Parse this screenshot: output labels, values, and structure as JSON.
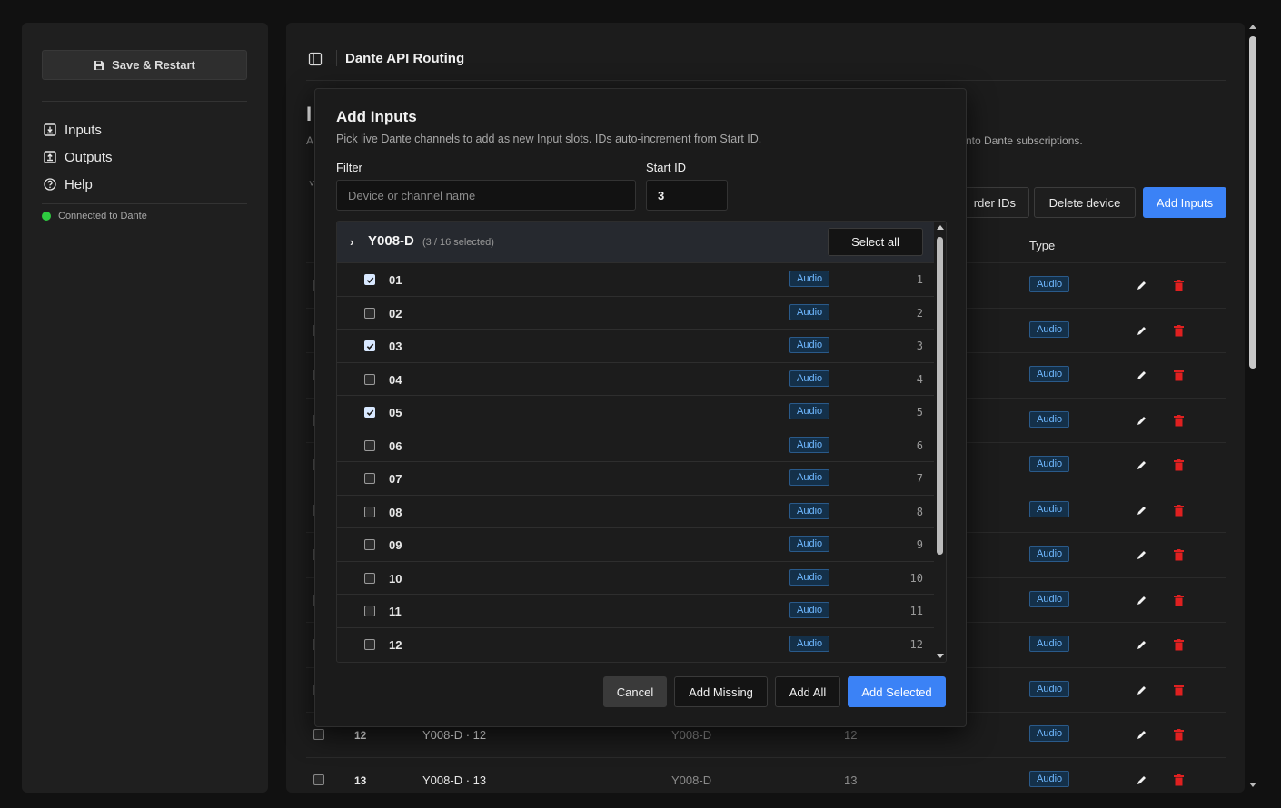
{
  "sidebar": {
    "save_label": "Save & Restart",
    "nav": [
      {
        "label": "Inputs",
        "icon": "import-icon"
      },
      {
        "label": "Outputs",
        "icon": "export-icon"
      },
      {
        "label": "Help",
        "icon": "help-circle-icon"
      }
    ],
    "status": "Connected to Dante",
    "status_color": "#2ecc40"
  },
  "header": {
    "title": "Dante API Routing"
  },
  "background": {
    "heading": "I",
    "desc_prefix": "A",
    "desc": "nto Dante subscriptions.",
    "toolbar": {
      "reorder_label": "rder IDs",
      "delete_label": "Delete device",
      "add_label": "Add Inputs"
    },
    "type_header": "Type",
    "badge": "Audio",
    "rows": [
      {
        "id": "12",
        "name": "Y008-D · 12",
        "device": "Y008-D",
        "channel": "12"
      },
      {
        "id": "13",
        "name": "Y008-D · 13",
        "device": "Y008-D",
        "channel": "13"
      }
    ]
  },
  "modal": {
    "title": "Add Inputs",
    "subtitle": "Pick live Dante channels to add as new Input slots. IDs auto-increment from Start ID.",
    "filter_label": "Filter",
    "filter_placeholder": "Device or channel name",
    "filter_value": "",
    "start_label": "Start ID",
    "start_value": "3",
    "group": {
      "name": "Y008-D",
      "count": "(3 / 16 selected)",
      "select_all": "Select all"
    },
    "channels": [
      {
        "name": "01",
        "checked": true,
        "type": "Audio",
        "num": "1"
      },
      {
        "name": "02",
        "checked": false,
        "type": "Audio",
        "num": "2"
      },
      {
        "name": "03",
        "checked": true,
        "type": "Audio",
        "num": "3"
      },
      {
        "name": "04",
        "checked": false,
        "type": "Audio",
        "num": "4"
      },
      {
        "name": "05",
        "checked": true,
        "type": "Audio",
        "num": "5"
      },
      {
        "name": "06",
        "checked": false,
        "type": "Audio",
        "num": "6"
      },
      {
        "name": "07",
        "checked": false,
        "type": "Audio",
        "num": "7"
      },
      {
        "name": "08",
        "checked": false,
        "type": "Audio",
        "num": "8"
      },
      {
        "name": "09",
        "checked": false,
        "type": "Audio",
        "num": "9"
      },
      {
        "name": "10",
        "checked": false,
        "type": "Audio",
        "num": "10"
      },
      {
        "name": "11",
        "checked": false,
        "type": "Audio",
        "num": "11"
      },
      {
        "name": "12",
        "checked": false,
        "type": "Audio",
        "num": "12"
      }
    ],
    "buttons": {
      "cancel": "Cancel",
      "add_missing": "Add Missing",
      "add_all": "Add All",
      "add_selected": "Add Selected"
    }
  },
  "colors": {
    "accent": "#3b82f6",
    "delete": "#e02020",
    "badge_text": "#6fb8ff"
  }
}
